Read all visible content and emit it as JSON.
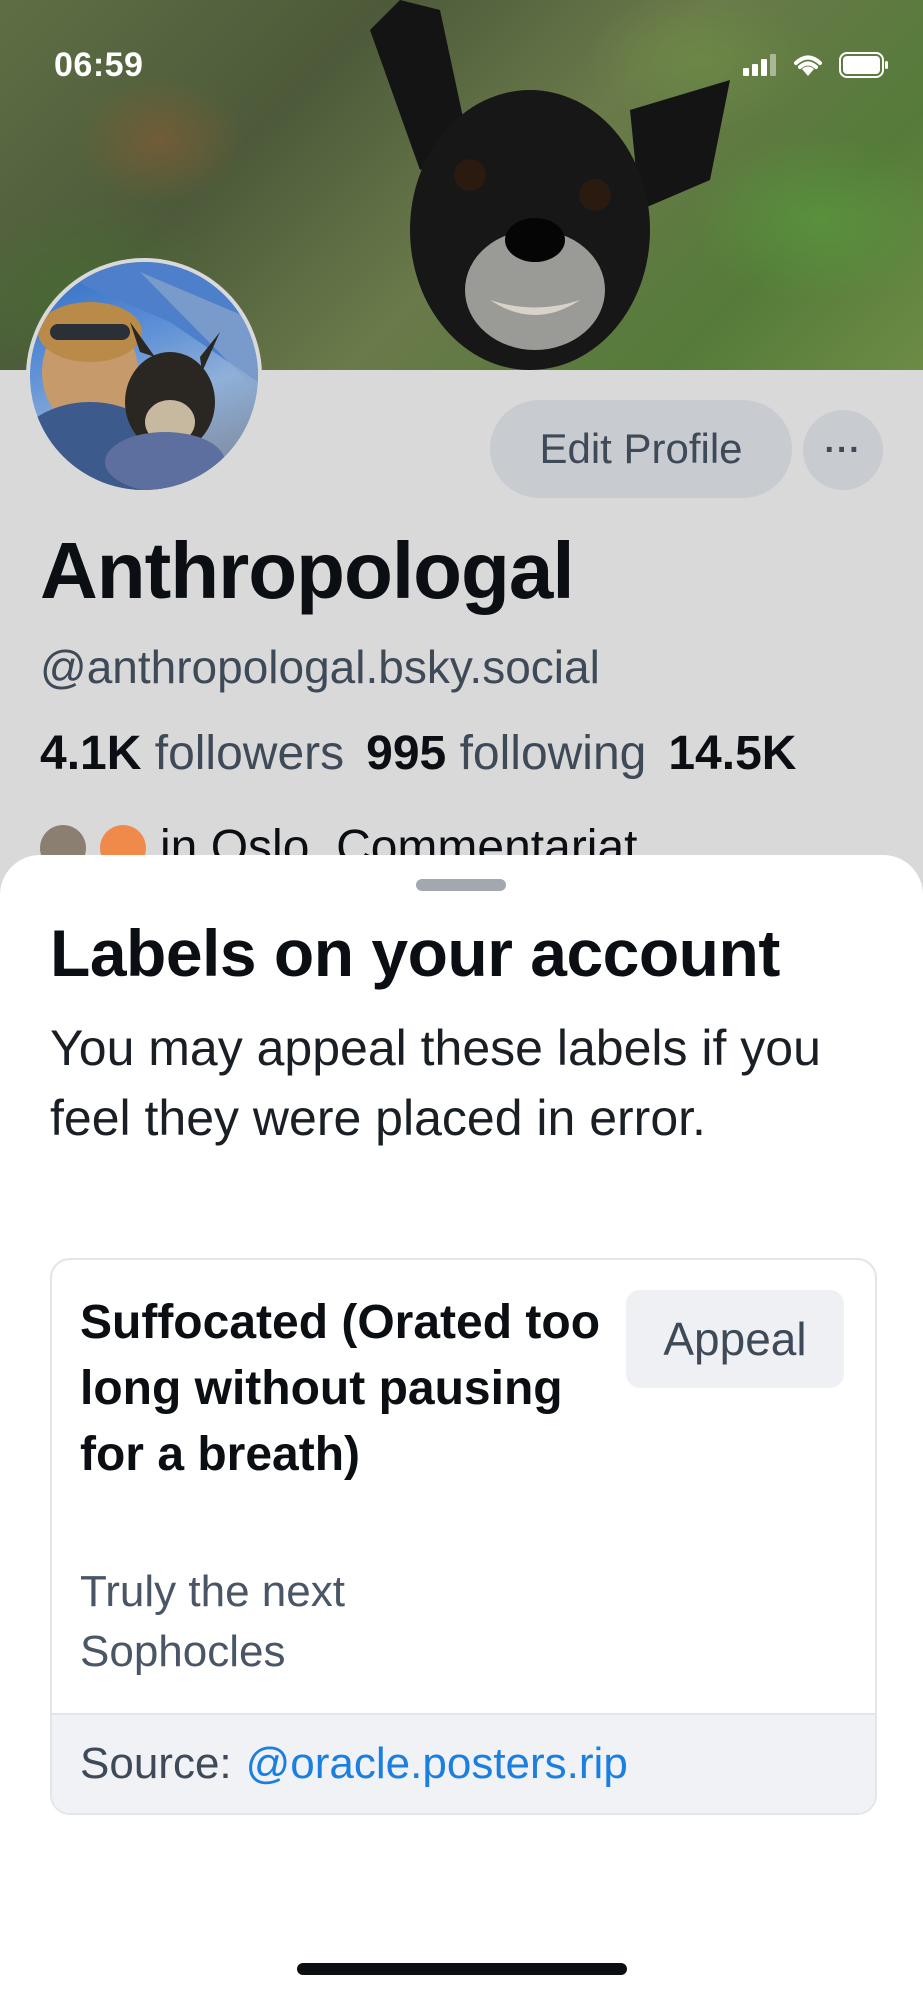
{
  "status_bar": {
    "time": "06:59",
    "icons": [
      "signal-icon",
      "wifi-icon",
      "battery-icon"
    ]
  },
  "profile": {
    "edit_profile_label": "Edit Profile",
    "more_label": "···",
    "display_name": "Anthropologal",
    "handle": "@anthropologal.bsky.social",
    "stats": [
      {
        "count": "4.1K",
        "label": "followers"
      },
      {
        "count": "995",
        "label": "following"
      },
      {
        "count": "14.5K",
        "label": ""
      }
    ],
    "bio_peek": "in Oslo. Commentariat"
  },
  "sheet": {
    "title": "Labels on your account",
    "description": "You may appeal these labels if you feel they were placed in error.",
    "label": {
      "name": "Suffocated (Orated too long without pausing for a breath)",
      "description": "Truly the next Sophocles",
      "appeal_label": "Appeal",
      "source_prefix": "Source:",
      "source_handle": "@oracle.posters.rip"
    }
  },
  "colors": {
    "accent_link": "#1a7fe0",
    "text_primary": "#0b0f14",
    "text_secondary": "#3f4a59",
    "button_bg": "#c8cbd0"
  }
}
